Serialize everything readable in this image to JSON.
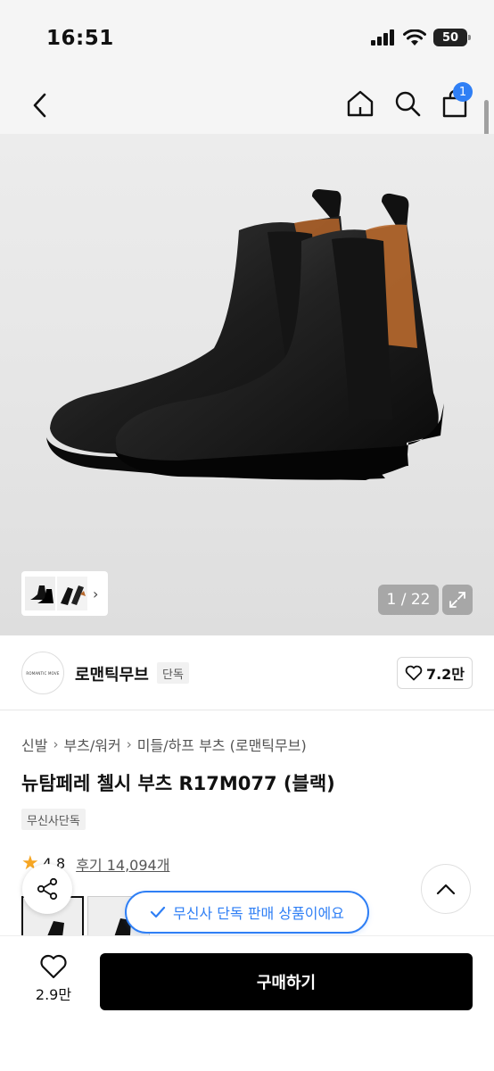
{
  "status_bar": {
    "time": "16:51",
    "battery": "50"
  },
  "nav": {
    "cart_count": "1"
  },
  "gallery": {
    "counter": "1 / 22"
  },
  "brand": {
    "logo_text": "ROMANTIC MOVE",
    "name": "로맨틱무브",
    "tag": "단독",
    "likes": "7.2만"
  },
  "breadcrumb": [
    "신발",
    "부츠/워커",
    "미들/하프 부츠 (로맨틱무브)"
  ],
  "product": {
    "title": "뉴탐페레 첼시 부츠 R17M077 (블랙)",
    "exclusive_tag": "무신사단독",
    "rating": "4.8",
    "reviews": "후기 14,094개"
  },
  "exclusive_notice": "무신사 단독 판매 상품이에요",
  "bottom_bar": {
    "wish_count": "2.9만",
    "buy_label": "구매하기"
  },
  "colors": {
    "accent": "#2f7ff5",
    "star": "#f6a623",
    "buy_button": "#000000"
  },
  "icons": [
    "back-icon",
    "home-icon",
    "search-icon",
    "shopping-bag-icon",
    "expand-icon",
    "heart-icon",
    "share-icon",
    "chevron-up-icon",
    "check-icon",
    "star-icon"
  ]
}
